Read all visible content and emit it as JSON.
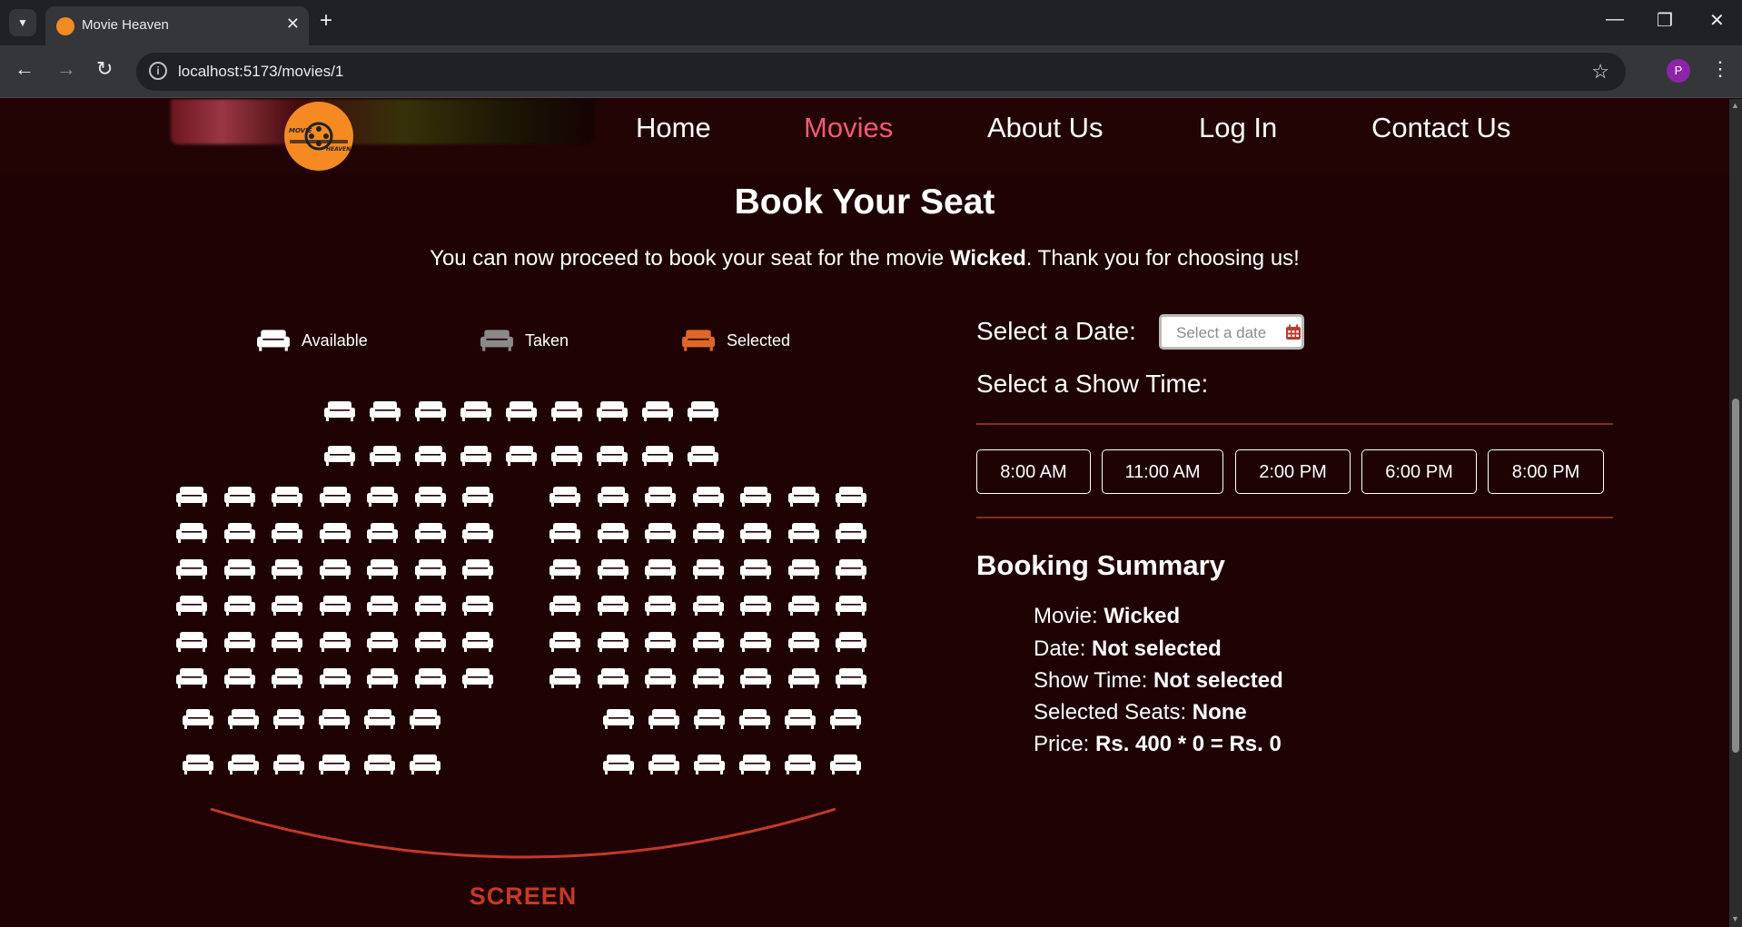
{
  "browser": {
    "tab_title": "Movie Heaven",
    "url": "localhost:5173/movies/1",
    "profile_initial": "P"
  },
  "site": {
    "nav": {
      "home": "Home",
      "movies": "Movies",
      "about": "About Us",
      "login": "Log In",
      "contact": "Contact Us"
    },
    "logo_text_top": "MOVIE",
    "logo_text_bottom": "HEAVEN",
    "active_color": "#ef5b73"
  },
  "booking": {
    "title": "Book Your Seat",
    "intro_before": "You can now proceed to book your seat for the movie ",
    "movie": "Wicked",
    "intro_after": ". Thank you for choosing us!",
    "legend": {
      "available": "Available",
      "taken": "Taken",
      "selected": "Selected"
    },
    "legend_colors": {
      "available": "#ffffff",
      "taken": "#8a8a8a",
      "selected": "#e0672a"
    },
    "screen_label": "SCREEN",
    "date_label": "Select a Date:",
    "date_placeholder": "Select a date",
    "time_label": "Select a Show Time:",
    "times": [
      "8:00 AM",
      "11:00 AM",
      "2:00 PM",
      "6:00 PM",
      "8:00 PM"
    ],
    "seat_rows": [
      9,
      9,
      14,
      14,
      14,
      14,
      14,
      14,
      12,
      12
    ]
  },
  "summary": {
    "title": "Booking Summary",
    "movie_label": "Movie: ",
    "movie_value": "Wicked",
    "date_label": "Date: ",
    "date_value": "Not selected",
    "time_label": "Show Time: ",
    "time_value": "Not selected",
    "seats_label": "Selected Seats: ",
    "seats_value": "None",
    "price_label": "Price: ",
    "price_value": "Rs. 400 * 0 = Rs. 0"
  }
}
